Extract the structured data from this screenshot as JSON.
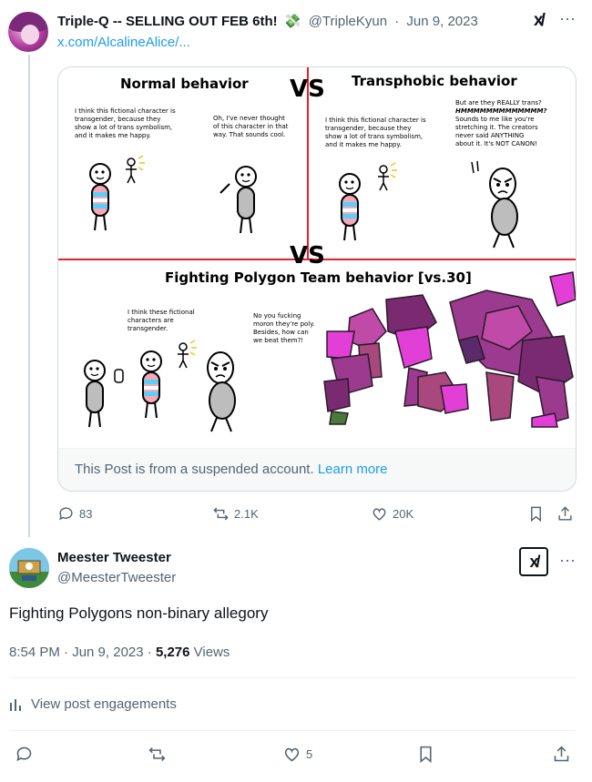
{
  "parent_post": {
    "author_name": "Triple-Q -- SELLING OUT FEB 6th!",
    "emoji": "💸",
    "handle": "@TripleKyun",
    "separator": "·",
    "date": "Jun 9, 2023",
    "link_text": "x.com/AlcalineAlice/...",
    "more_label": "···",
    "grok_label": "x/"
  },
  "comic": {
    "title_normal": "Normal behavior",
    "title_transphobic": "Transphobic behavior",
    "vs_top": "VS",
    "vs_middle": "VS",
    "title_bottom": "Fighting Polygon Team behavior [vs.30]",
    "normal_speech_1": [
      "I think this fictional character is",
      "transgender, because they",
      "show a lot of trans symbolism,",
      "and it makes me happy."
    ],
    "normal_speech_2": [
      "Oh, I've never thought",
      "of this character in that",
      "way. That sounds cool."
    ],
    "trans_speech_1": [
      "I think this fictional character is",
      "transgender, because they",
      "show a lot of trans symbolism,",
      "and it makes me happy."
    ],
    "trans_speech_2": [
      "But are they REALLY trans?",
      "HMMMMMMMMMMMMM?",
      "Sounds to me like you're",
      "stretching it. The creators",
      "never said ANYTHING",
      "about it. It's NOT CANON!"
    ],
    "bottom_speech_1": [
      "I think these fictional",
      "characters are",
      "transgender."
    ],
    "bottom_speech_2": [
      "No you fucking",
      "moron they're poly.",
      "Besides, how can",
      "we beat them?!"
    ]
  },
  "suspended": {
    "text": "This Post is from a suspended account.",
    "link": "Learn more"
  },
  "parent_actions": {
    "replies": "83",
    "reposts": "2.1K",
    "likes": "20K"
  },
  "reply_post": {
    "author_name": "Meester Tweester",
    "handle": "@MeesterTweester",
    "text": "Fighting Polygons non-binary allegory",
    "time": "8:54 PM · Jun 9, 2023 ·",
    "views_count": "5,276",
    "views_label": "Views",
    "engagements_label": "View post engagements",
    "likes": "5",
    "more_label": "···",
    "grok_label": "x/"
  },
  "colors": {
    "accent": "#1d9bf0",
    "secondary_text": "#536471",
    "border": "#cfd9de",
    "comic_red": "#e8202a",
    "polygon_purple": "#9b3a8e",
    "polygon_magenta": "#e23fd6"
  }
}
